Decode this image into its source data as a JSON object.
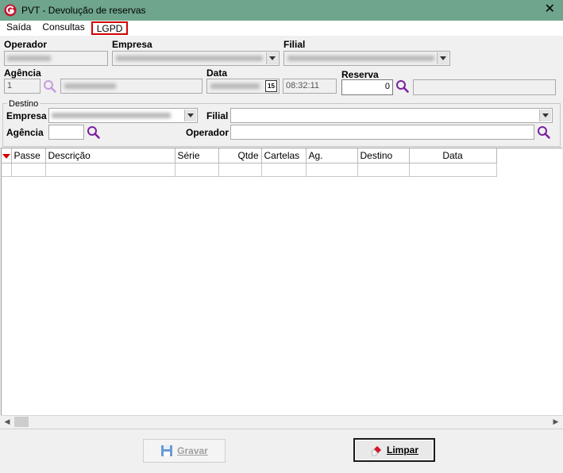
{
  "window": {
    "title": "PVT - Devolução de reservas",
    "close_glyph": "✕"
  },
  "menu": {
    "items": [
      "Saída",
      "Consultas",
      "LGPD"
    ]
  },
  "origin": {
    "operador_label": "Operador",
    "empresa_label": "Empresa",
    "filial_label": "Filial",
    "agencia_label": "Agência",
    "agencia_value": "1",
    "data_label": "Data",
    "time_value": "08:32:11",
    "calendar_glyph": "15",
    "reserva_label": "Reserva",
    "reserva_value": "0"
  },
  "destino": {
    "legend": "Destino",
    "empresa_label": "Empresa",
    "filial_label": "Filial",
    "agencia_label": "Agência",
    "operador_label": "Operador"
  },
  "grid": {
    "columns": [
      "Passe",
      "Descrição",
      "Série",
      "Qtde",
      "Cartelas",
      "Ag.",
      "Destino",
      "Data"
    ]
  },
  "buttons": {
    "gravar": "Gravar",
    "limpar": "Limpar"
  },
  "colors": {
    "titlebar": "#6ea58c",
    "accent_red": "#d40000",
    "search_purple": "#7a1fa2"
  }
}
